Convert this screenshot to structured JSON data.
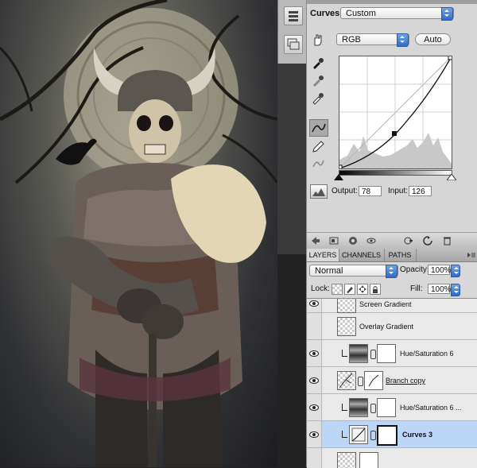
{
  "adjustments": {
    "type_label": "Curves",
    "preset_value": "Custom",
    "channel_value": "RGB",
    "auto_label": "Auto",
    "output_label": "Output:",
    "output_value": "78",
    "input_label": "Input:",
    "input_value": "126"
  },
  "layers_panel": {
    "tabs": [
      "LAYERS",
      "CHANNELS",
      "PATHS"
    ],
    "blend_mode": "Normal",
    "opacity_label": "Opacity:",
    "opacity_value": "100%",
    "lock_label": "Lock:",
    "fill_label": "Fill:",
    "fill_value": "100%",
    "layers": [
      {
        "name": "Screen Gradient"
      },
      {
        "name": "Overlay Gradient"
      },
      {
        "name": "Hue/Saturation 6"
      },
      {
        "name": "Branch copy"
      },
      {
        "name": "Hue/Saturation 6 ..."
      },
      {
        "name": "Curves 3"
      }
    ]
  },
  "colors": {
    "selection": "#bcd6f7",
    "accent_blue": "#2f6bc8",
    "panel_bg": "#d6d6d6"
  }
}
